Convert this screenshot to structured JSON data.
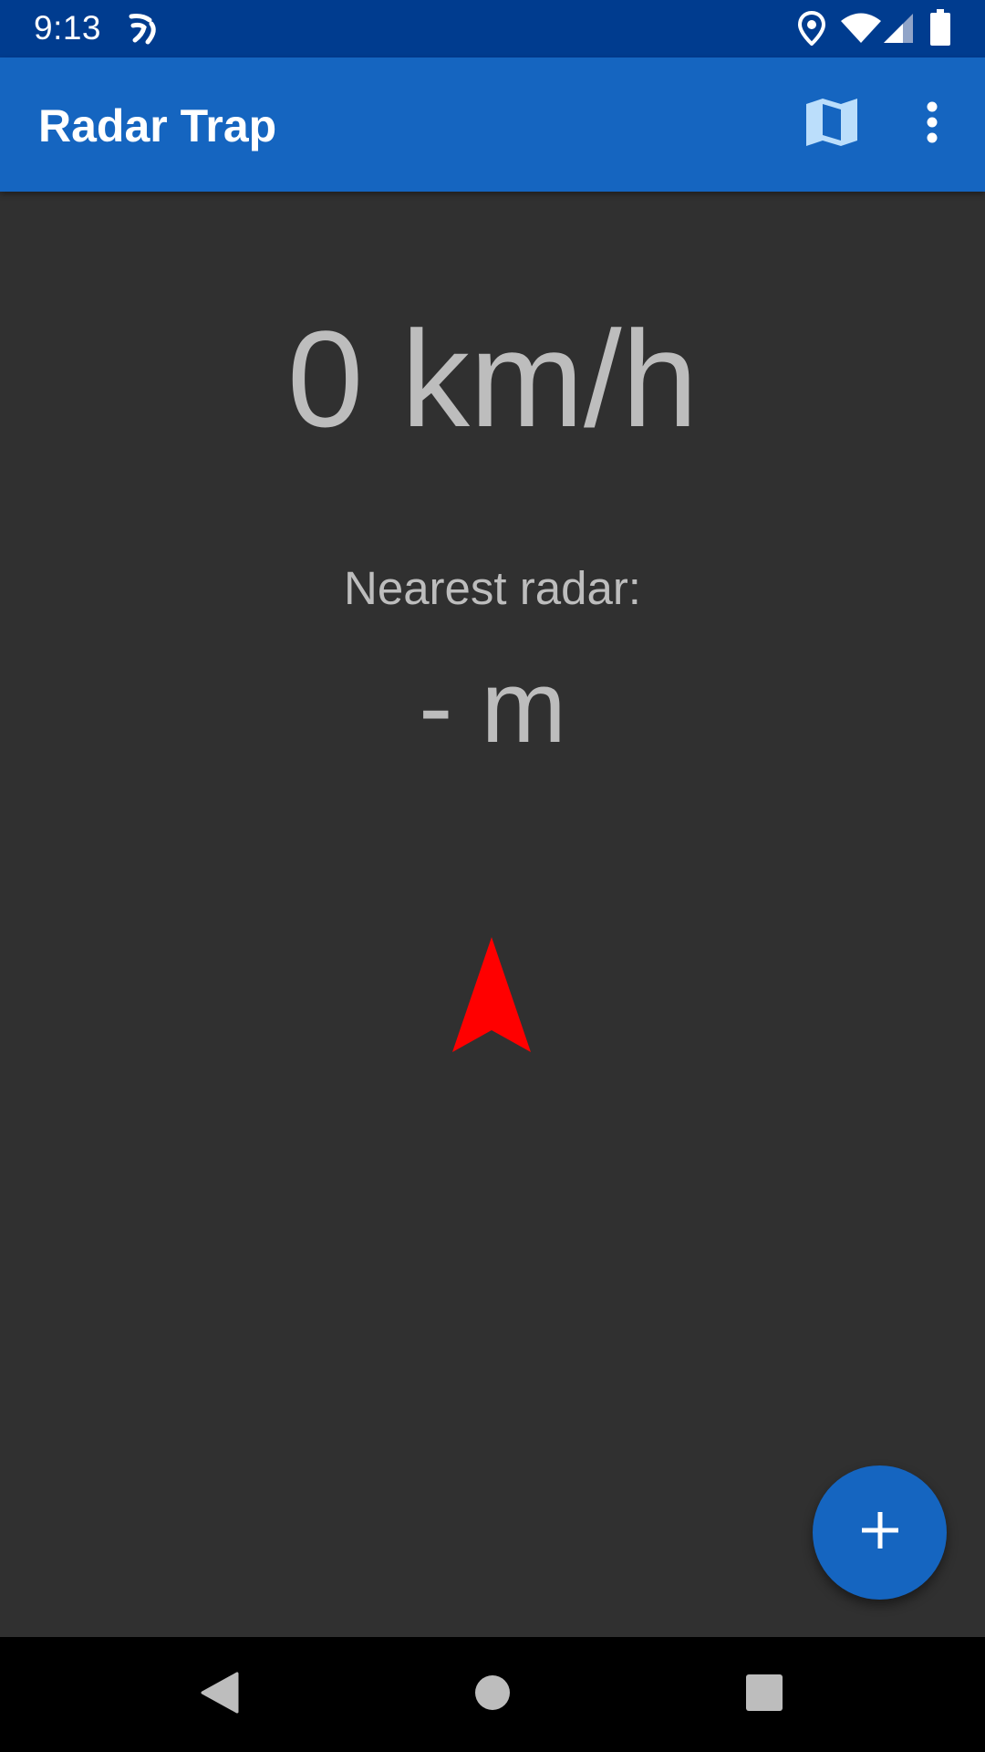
{
  "status_bar": {
    "time": "9:13",
    "icons": [
      "cast-icon",
      "location-icon",
      "wifi-icon",
      "signal-icon",
      "battery-icon"
    ],
    "background_color": "#003c8f"
  },
  "app_bar": {
    "title": "Radar Trap",
    "actions": [
      "map-icon",
      "more-vert-icon"
    ],
    "background_color": "#1565c0"
  },
  "main": {
    "speed_value": "0",
    "speed_unit": "km/h",
    "speed_display": "0 km/h",
    "nearest_label": "Nearest radar:",
    "distance_display": "- m",
    "direction_icon": "navigation-arrow-icon",
    "arrow_color": "#ff0000",
    "text_color": "#bdbdbd",
    "background_color": "#303030"
  },
  "fab": {
    "icon": "add-icon",
    "color": "#1565c0"
  },
  "nav_bar": {
    "buttons": [
      "back-icon",
      "home-icon",
      "recents-icon"
    ]
  }
}
